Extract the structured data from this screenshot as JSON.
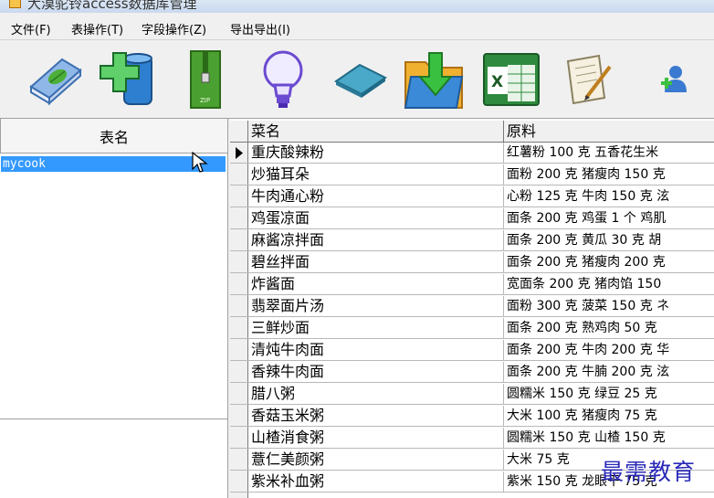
{
  "window": {
    "title": "大漠驼铃access数据库管理"
  },
  "menu": [
    {
      "label": "文件(F)"
    },
    {
      "label": "表操作(T)"
    },
    {
      "label": "字段操作(Z)"
    },
    {
      "label": "导出导出(I)"
    }
  ],
  "toolbar": [
    {
      "icon": "book-leaf-icon"
    },
    {
      "icon": "add-database-icon"
    },
    {
      "icon": "zip-archive-icon"
    },
    {
      "icon": "lightbulb-icon"
    },
    {
      "icon": "eraser-icon"
    },
    {
      "icon": "folder-download-icon"
    },
    {
      "icon": "excel-icon"
    },
    {
      "icon": "document-pen-icon"
    },
    {
      "icon": "user-add-icon"
    }
  ],
  "tables_panel": {
    "header": "表名",
    "items": [
      "mycook"
    ]
  },
  "grid": {
    "columns": [
      "菜名",
      "原料"
    ],
    "rows": [
      {
        "name": "重庆酸辣粉",
        "material": "红薯粉 100 克 五香花生米"
      },
      {
        "name": "炒猫耳朵",
        "material": "面粉 200 克 猪瘦肉 150 克"
      },
      {
        "name": "牛肉通心粉",
        "material": "心粉 125 克 牛肉 150 克 泫"
      },
      {
        "name": "鸡蛋凉面",
        "material": "面条 200 克 鸡蛋 1 个 鸡肌"
      },
      {
        "name": "麻酱凉拌面",
        "material": "面条 200 克 黄瓜 30 克 胡"
      },
      {
        "name": "碧丝拌面",
        "material": "面条 200 克 猪瘦肉 200 克"
      },
      {
        "name": "炸酱面",
        "material": "宽面条 200 克 猪肉馅 150"
      },
      {
        "name": "翡翠面片汤",
        "material": "面粉 300 克 菠菜 150 克 ネ"
      },
      {
        "name": "三鲜炒面",
        "material": "面条 200 克 熟鸡肉 50 克"
      },
      {
        "name": "清炖牛肉面",
        "material": "面条 200 克 牛肉 200 克 华"
      },
      {
        "name": "香辣牛肉面",
        "material": "面条 200 克 牛腩 200 克 泫"
      },
      {
        "name": "腊八粥",
        "material": "圆糯米 150 克 绿豆 25 克"
      },
      {
        "name": "香菇玉米粥",
        "material": "大米 100 克 猪瘦肉 75 克"
      },
      {
        "name": "山楂消食粥",
        "material": "圆糯米 150 克 山楂 150 克"
      },
      {
        "name": "薏仁美颜粥",
        "material": "大米 75 克"
      },
      {
        "name": "紫米补血粥",
        "material": "紫米 150 克 龙眼干 75 克"
      }
    ]
  },
  "watermark": "最需教育"
}
